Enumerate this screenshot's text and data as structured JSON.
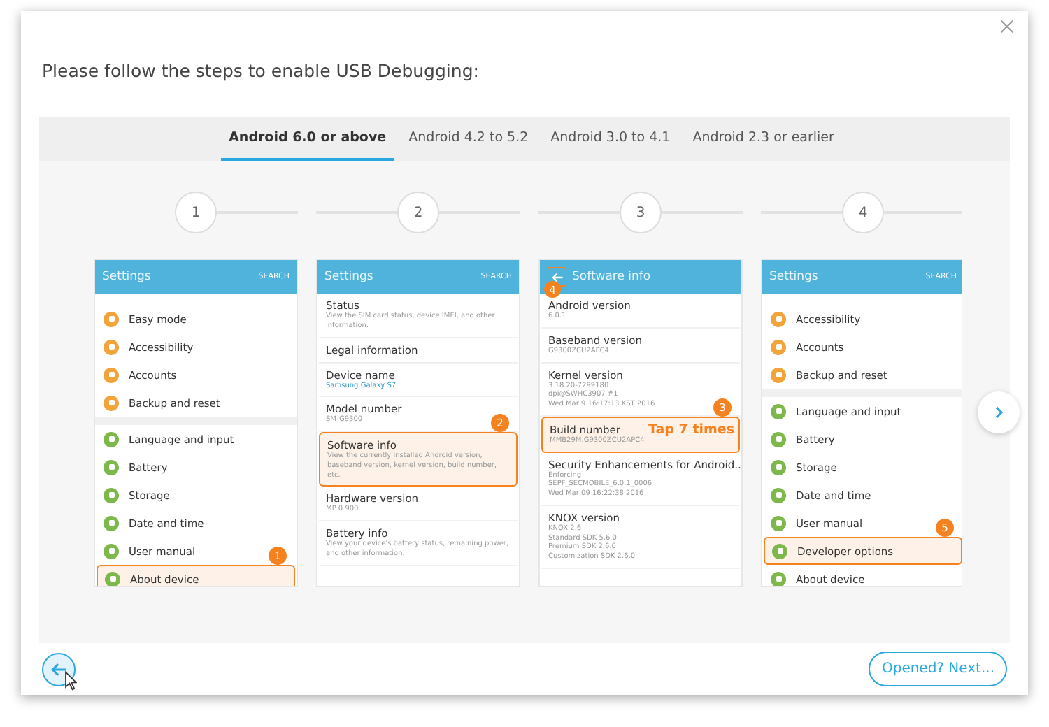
{
  "dialog": {
    "title": "Please follow the steps to enable USB Debugging:"
  },
  "tabs": [
    {
      "label": "Android 6.0 or above",
      "selected": true
    },
    {
      "label": "Android 4.2 to 5.2",
      "selected": false
    },
    {
      "label": "Android 3.0 to 4.1",
      "selected": false
    },
    {
      "label": "Android 2.3 or earlier",
      "selected": false
    }
  ],
  "steps": [
    {
      "number": "1",
      "screen": {
        "header": {
          "kind": "menu",
          "title": "Settings",
          "action": "SEARCH"
        },
        "rows": [
          {
            "kind": "item",
            "label": "Easy mode",
            "color": "#f2a33a"
          },
          {
            "kind": "item",
            "label": "Accessibility",
            "color": "#f2a33a"
          },
          {
            "kind": "item",
            "label": "Accounts",
            "color": "#f2a33a"
          },
          {
            "kind": "item",
            "label": "Backup and reset",
            "color": "#f2a33a"
          },
          {
            "kind": "gap"
          },
          {
            "kind": "item",
            "label": "Language and input",
            "color": "#7cb84a"
          },
          {
            "kind": "item",
            "label": "Battery",
            "color": "#7cb84a"
          },
          {
            "kind": "item",
            "label": "Storage",
            "color": "#7cb84a"
          },
          {
            "kind": "item",
            "label": "Date and time",
            "color": "#7cb84a"
          },
          {
            "kind": "item",
            "label": "User manual",
            "color": "#7cb84a"
          },
          {
            "kind": "item",
            "label": "About device",
            "color": "#7cb84a",
            "highlighted": true,
            "badge": "1"
          }
        ]
      }
    },
    {
      "number": "2",
      "screen": {
        "header": {
          "kind": "menu",
          "title": "Settings",
          "action": "SEARCH"
        },
        "rows": [
          {
            "kind": "info",
            "title": "Status",
            "lines": [
              "View the SIM card status, device IMEI, and other information."
            ]
          },
          {
            "kind": "info",
            "title": "Legal information"
          },
          {
            "kind": "info",
            "title": "Device name",
            "lines": [
              "Samsung Galaxy S7"
            ],
            "accent": true
          },
          {
            "kind": "info",
            "title": "Model number",
            "lines": [
              "SM-G9300"
            ]
          },
          {
            "kind": "info",
            "title": "Software info",
            "lines": [
              "View the currently installed Android version, baseband version, kernel version, build number, etc."
            ],
            "highlighted": true,
            "badge": "2"
          },
          {
            "kind": "info",
            "title": "Hardware version",
            "lines": [
              "MP 0.900"
            ]
          },
          {
            "kind": "info",
            "title": "Battery info",
            "lines": [
              "View your device's battery status, remaining power, and other information."
            ]
          }
        ]
      }
    },
    {
      "number": "3",
      "screen": {
        "header": {
          "kind": "back",
          "title": "Software info",
          "highlighted": true,
          "badge": "4"
        },
        "rows": [
          {
            "kind": "info",
            "title": "Android version",
            "lines": [
              "6.0.1"
            ]
          },
          {
            "kind": "info",
            "title": "Baseband version",
            "lines": [
              "G9300ZCU2APC4"
            ]
          },
          {
            "kind": "info",
            "title": "Kernel version",
            "lines": [
              "3.18.20-7299180",
              "dpi@SWHC3907 #1",
              "Wed Mar 9 16:17:13 KST 2016"
            ]
          },
          {
            "kind": "info",
            "title": "Build number",
            "lines": [
              "MMB29M.G9300ZCU2APC4"
            ],
            "highlighted": true,
            "badge": "3",
            "note": "Tap 7 times"
          },
          {
            "kind": "info",
            "title": "Security Enhancements for Android...",
            "lines": [
              "Enforcing",
              "SEPF_SECMOBILE_6.0.1_0006",
              "Wed Mar 09 16:22:38 2016"
            ]
          },
          {
            "kind": "info",
            "title": "KNOX version",
            "lines": [
              "KNOX 2.6",
              "Standard SDK 5.6.0",
              "Premium SDK 2.6.0",
              "Customization SDK 2.6.0"
            ]
          }
        ]
      }
    },
    {
      "number": "4",
      "screen": {
        "header": {
          "kind": "menu",
          "title": "Settings",
          "action": "SEARCH"
        },
        "rows": [
          {
            "kind": "item",
            "label": "Accessibility",
            "color": "#f2a33a"
          },
          {
            "kind": "item",
            "label": "Accounts",
            "color": "#f2a33a"
          },
          {
            "kind": "item",
            "label": "Backup and reset",
            "color": "#f2a33a"
          },
          {
            "kind": "gap"
          },
          {
            "kind": "item",
            "label": "Language and input",
            "color": "#7cb84a"
          },
          {
            "kind": "item",
            "label": "Battery",
            "color": "#7cb84a"
          },
          {
            "kind": "item",
            "label": "Storage",
            "color": "#7cb84a"
          },
          {
            "kind": "item",
            "label": "Date and time",
            "color": "#7cb84a"
          },
          {
            "kind": "item",
            "label": "User manual",
            "color": "#7cb84a"
          },
          {
            "kind": "item",
            "label": "Developer options",
            "color": "#7cb84a",
            "highlighted": true,
            "badge": "5"
          },
          {
            "kind": "item",
            "label": "About device",
            "color": "#7cb84a"
          }
        ]
      }
    }
  ],
  "footer": {
    "next_button": "Opened? Next..."
  }
}
